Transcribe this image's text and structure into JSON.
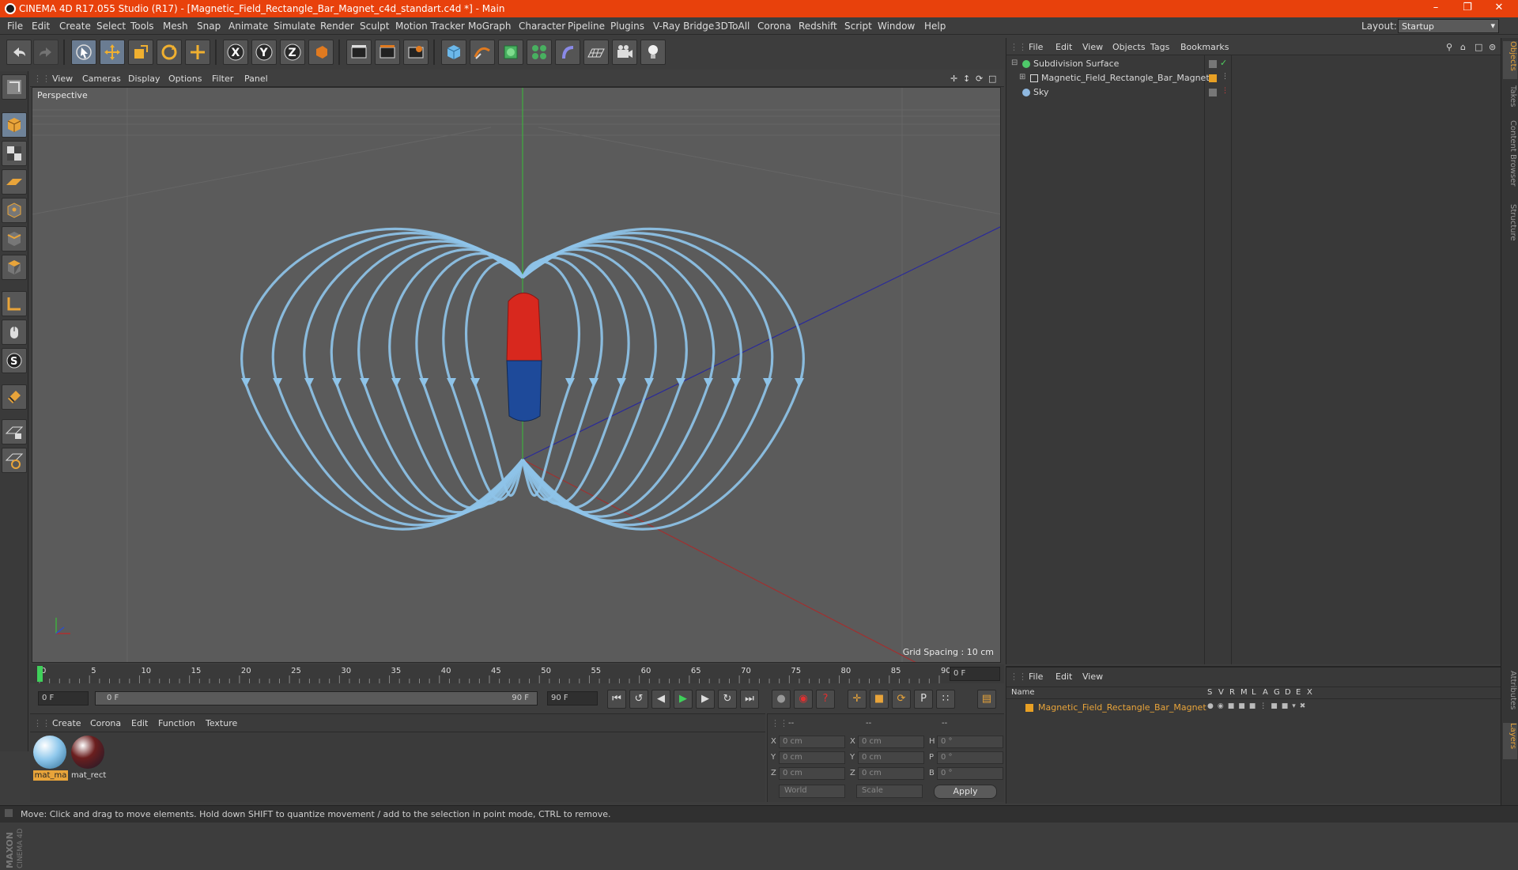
{
  "window": {
    "title": "CINEMA 4D R17.055 Studio (R17) - [Magnetic_Field_Rectangle_Bar_Magnet_c4d_standart.c4d *] - Main"
  },
  "menu": [
    "File",
    "Edit",
    "Create",
    "Select",
    "Tools",
    "Mesh",
    "Snap",
    "Animate",
    "Simulate",
    "Render",
    "Sculpt",
    "Motion Tracker",
    "MoGraph",
    "Character",
    "Pipeline",
    "Plugins",
    "V-Ray Bridge",
    "3DToAll",
    "Corona",
    "Redshift",
    "Script",
    "Window",
    "Help"
  ],
  "layout": {
    "label": "Layout:",
    "value": "Startup"
  },
  "viewport": {
    "menu": [
      "View",
      "Cameras",
      "Display",
      "Options",
      "Filter",
      "Panel"
    ],
    "camera_label": "Perspective",
    "grid_spacing": "Grid Spacing : 10 cm"
  },
  "timeline": {
    "ticks": [
      "0",
      "5",
      "10",
      "15",
      "20",
      "25",
      "30",
      "35",
      "40",
      "45",
      "50",
      "55",
      "60",
      "65",
      "70",
      "75",
      "80",
      "85",
      "90"
    ],
    "current_frame_box": "0 F",
    "start_frame": "0 F",
    "range_start": "0 F",
    "range_end": "90 F",
    "end_frame": "90 F"
  },
  "material_manager": {
    "menu": [
      "Create",
      "Corona",
      "Edit",
      "Function",
      "Texture"
    ],
    "materials": [
      {
        "name": "mat_ma",
        "color": "#8fc8ec"
      },
      {
        "name": "mat_rect",
        "color": "#6b1e1e"
      }
    ]
  },
  "coordinates": {
    "header": [
      "--",
      "--",
      "--"
    ],
    "rows": [
      {
        "a": "X",
        "av": "0 cm",
        "b": "X",
        "bv": "0 cm",
        "c": "H",
        "cv": "0 °"
      },
      {
        "a": "Y",
        "av": "0 cm",
        "b": "Y",
        "bv": "0 cm",
        "c": "P",
        "cv": "0 °"
      },
      {
        "a": "Z",
        "av": "0 cm",
        "b": "Z",
        "bv": "0 cm",
        "c": "B",
        "cv": "0 °"
      }
    ],
    "mode_world": "World",
    "mode_scale": "Scale",
    "apply": "Apply"
  },
  "object_manager": {
    "menu": [
      "File",
      "Edit",
      "View",
      "Objects",
      "Tags",
      "Bookmarks"
    ],
    "objects": [
      {
        "name": "Subdivision Surface",
        "icon_color": "#4fc86a"
      },
      {
        "name": "Magnetic_Field_Rectangle_Bar_Magnet",
        "icon_color": "#cfcfcf"
      },
      {
        "name": "Sky",
        "icon_color": "#8fb8e0"
      }
    ]
  },
  "layer_manager": {
    "menu": [
      "File",
      "Edit",
      "View"
    ],
    "columns": [
      "Name",
      "S",
      "V",
      "R",
      "M",
      "L",
      "A",
      "G",
      "D",
      "E",
      "X"
    ],
    "layers": [
      {
        "name": "Magnetic_Field_Rectangle_Bar_Magnet",
        "color": "#e8a024"
      }
    ]
  },
  "right_tabs": [
    "Objects",
    "Takes",
    "Content Browser",
    "Structure"
  ],
  "right_tabs_bottom": [
    "Attributes",
    "Layers"
  ],
  "status": "Move: Click and drag to move elements. Hold down SHIFT to quantize movement / add to the selection in point mode, CTRL to remove.",
  "branding": {
    "maxon": "MAXON",
    "product": "CINEMA 4D"
  },
  "colors": {
    "titlebar": "#e8410c",
    "field_lines": "#8ec3e8",
    "magnet_north": "#d8281e",
    "magnet_south": "#1e4a9a",
    "accent": "#e8a43a"
  }
}
